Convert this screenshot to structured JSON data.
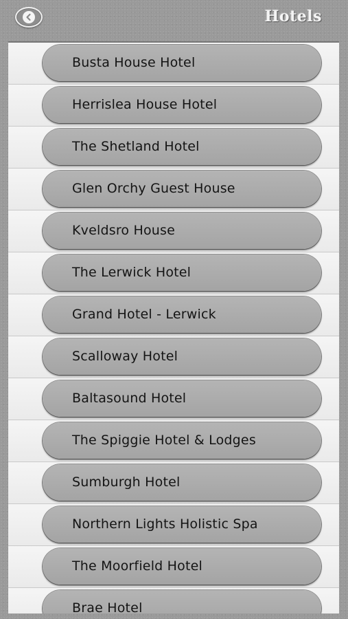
{
  "header": {
    "title": "Hotels",
    "back_icon": "chevron-left-circle-icon"
  },
  "hotels": [
    {
      "label": "Busta House Hotel"
    },
    {
      "label": "Herrislea House Hotel"
    },
    {
      "label": "The Shetland Hotel"
    },
    {
      "label": "Glen Orchy Guest House"
    },
    {
      "label": "Kveldsro House"
    },
    {
      "label": "The Lerwick Hotel"
    },
    {
      "label": "Grand Hotel - Lerwick"
    },
    {
      "label": "Scalloway Hotel"
    },
    {
      "label": "Baltasound Hotel"
    },
    {
      "label": "The Spiggie Hotel & Lodges"
    },
    {
      "label": "Sumburgh Hotel"
    },
    {
      "label": "Northern Lights Holistic Spa"
    },
    {
      "label": "The Moorfield Hotel"
    },
    {
      "label": "Brae Hotel"
    }
  ]
}
